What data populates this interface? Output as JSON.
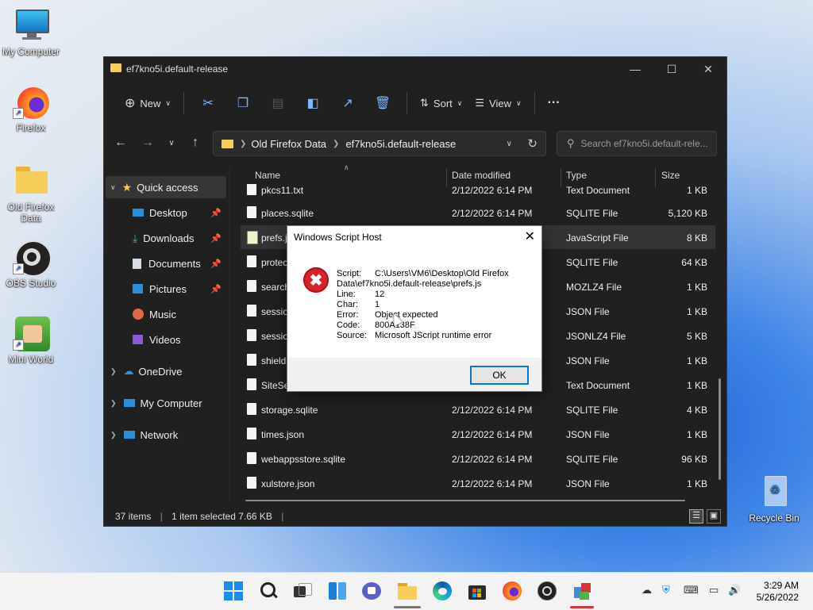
{
  "desktop": {
    "icons": [
      {
        "label": "My Computer",
        "icon": "monitor-icon"
      },
      {
        "label": "Firefox",
        "icon": "firefox-icon"
      },
      {
        "label": "Old Firefox Data",
        "icon": "folder-icon"
      },
      {
        "label": "OBS Studio",
        "icon": "obs-icon"
      },
      {
        "label": "Mini World",
        "icon": "mini-world-icon"
      },
      {
        "label": "Recycle Bin",
        "icon": "recycle-bin-icon"
      }
    ]
  },
  "explorer": {
    "title": "ef7kno5i.default-release",
    "toolbar": {
      "new": "New",
      "sort": "Sort",
      "view": "View"
    },
    "address": {
      "crumb1": "Old Firefox Data",
      "crumb2": "ef7kno5i.default-release"
    },
    "search_placeholder": "Search ef7kno5i.default-rele...",
    "sidebar": {
      "quick_access": "Quick access",
      "items": [
        "Desktop",
        "Downloads",
        "Documents",
        "Pictures",
        "Music",
        "Videos"
      ],
      "onedrive": "OneDrive",
      "my_computer": "My Computer",
      "network": "Network"
    },
    "columns": {
      "name": "Name",
      "date": "Date modified",
      "type": "Type",
      "size": "Size"
    },
    "files": [
      {
        "name": "pkcs11.txt",
        "date": "2/12/2022 6:14 PM",
        "type": "Text Document",
        "size": "1 KB"
      },
      {
        "name": "places.sqlite",
        "date": "2/12/2022 6:14 PM",
        "type": "SQLITE File",
        "size": "5,120 KB"
      },
      {
        "name": "prefs.js",
        "date": "",
        "type": "JavaScript File",
        "size": "8 KB"
      },
      {
        "name": "protections.sqlite",
        "date": "",
        "type": "SQLITE File",
        "size": "64 KB"
      },
      {
        "name": "search.json.mozlz4",
        "date": "",
        "type": "MOZLZ4 File",
        "size": "1 KB"
      },
      {
        "name": "sessionCheckpoints.json",
        "date": "",
        "type": "JSON File",
        "size": "1 KB"
      },
      {
        "name": "sessionstore.jsonlz4",
        "date": "",
        "type": "JSONLZ4 File",
        "size": "5 KB"
      },
      {
        "name": "shield-preference-experiments.json",
        "date": "",
        "type": "JSON File",
        "size": "1 KB"
      },
      {
        "name": "SiteSecurityServiceState.txt",
        "date": "",
        "type": "Text Document",
        "size": "1 KB"
      },
      {
        "name": "storage.sqlite",
        "date": "2/12/2022 6:14 PM",
        "type": "SQLITE File",
        "size": "4 KB"
      },
      {
        "name": "times.json",
        "date": "2/12/2022 6:14 PM",
        "type": "JSON File",
        "size": "1 KB"
      },
      {
        "name": "webappsstore.sqlite",
        "date": "2/12/2022 6:14 PM",
        "type": "SQLITE File",
        "size": "96 KB"
      },
      {
        "name": "xulstore.json",
        "date": "2/12/2022 6:14 PM",
        "type": "JSON File",
        "size": "1 KB"
      }
    ],
    "status": {
      "items": "37 items",
      "selected": "1 item selected  7.66 KB"
    }
  },
  "dialog": {
    "title": "Windows Script Host",
    "script_label": "Script:",
    "script_value": "C:\\Users\\VM6\\Desktop\\Old Firefox",
    "script_value2": "Data\\ef7kno5i.default-release\\prefs.js",
    "line_label": "Line:",
    "line_value": "12",
    "char_label": "Char:",
    "char_value": "1",
    "error_label": "Error:",
    "error_value": "Object expected",
    "code_label": "Code:",
    "code_value": "800A138F",
    "source_label": "Source:",
    "source_value": "Microsoft JScript runtime error",
    "ok": "OK"
  },
  "taskbar": {
    "time": "3:29 AM",
    "date": "5/26/2022"
  },
  "colors": {
    "accent": "#0078d7",
    "error_red": "#d4242a",
    "explorer_bg": "#202020"
  }
}
